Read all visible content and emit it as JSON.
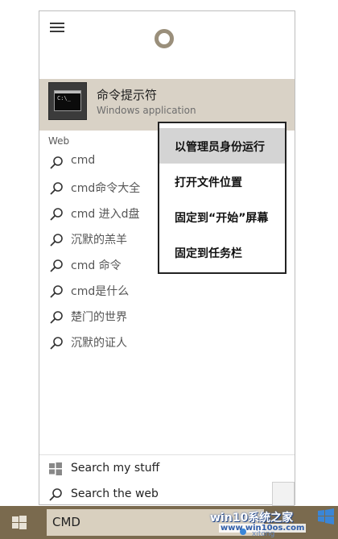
{
  "best_match": {
    "title": "命令提示符",
    "subtitle": "Windows application"
  },
  "web_section_label": "Web",
  "results": [
    "cmd",
    "cmd命令大全",
    "cmd 进入d盘",
    "沉默的羔羊",
    "cmd 命令",
    "cmd是什么",
    "楚门的世界",
    "沉默的证人"
  ],
  "bottom": {
    "my_stuff": "Search my stuff",
    "the_web": "Search the web"
  },
  "context_menu": [
    "以管理员身份运行",
    "打开文件位置",
    "固定到“开始”屏幕",
    "固定到任务栏"
  ],
  "taskbar": {
    "search_value": "CMD"
  },
  "watermark": {
    "title": "win10系统之家",
    "url": "www.win10os.com",
    "extra": "xitong"
  },
  "colors": {
    "best_match_bg": "#d9d2c6",
    "taskbar_bg": "#7a6a4e",
    "search_box_bg": "#d9d0bf",
    "menu_highlight": "#d4d4d4"
  }
}
